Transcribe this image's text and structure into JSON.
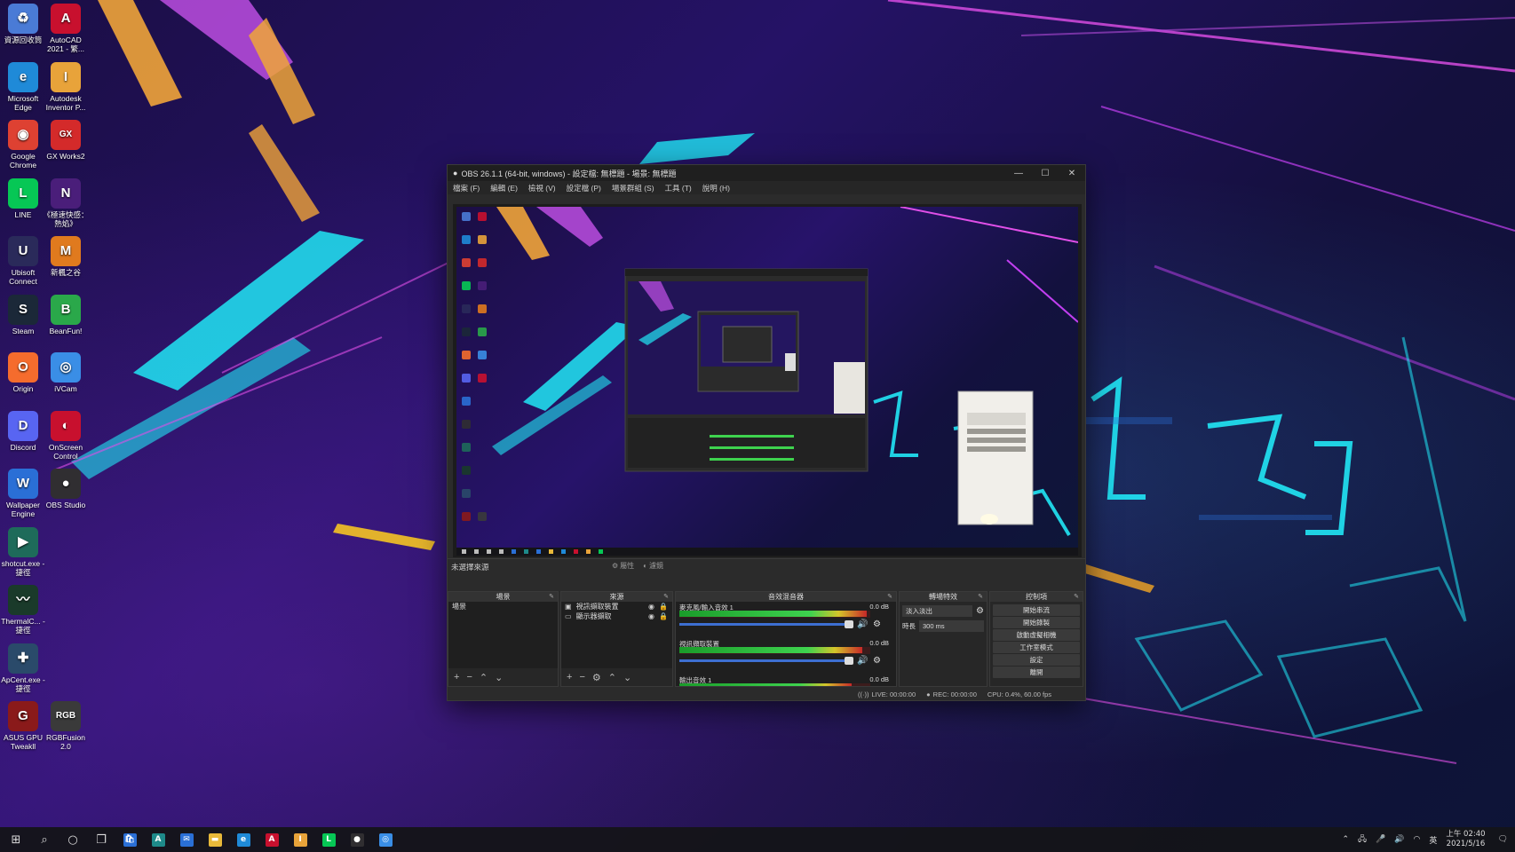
{
  "desktop": {
    "icons": [
      {
        "label": "資源回收筒",
        "icon": "recycle-bin-icon",
        "color": "#4a7bd6",
        "glyph": "♻"
      },
      {
        "label": "AutoCAD 2021 - 繁...",
        "icon": "autocad-icon",
        "color": "#c8102e",
        "glyph": "A"
      },
      {
        "label": "Microsoft Edge",
        "icon": "edge-icon",
        "color": "#1f8ad8",
        "glyph": "e"
      },
      {
        "label": "Autodesk Inventor P...",
        "icon": "inventor-icon",
        "color": "#e8a33a",
        "glyph": "I"
      },
      {
        "label": "Google Chrome",
        "icon": "chrome-icon",
        "color": "#de4132",
        "glyph": "◉"
      },
      {
        "label": "GX Works2",
        "icon": "gxworks-icon",
        "color": "#d42a2a",
        "glyph": "GX"
      },
      {
        "label": "LINE",
        "icon": "line-icon",
        "color": "#06c755",
        "glyph": "L"
      },
      {
        "label": "《極速快感：熱焰》",
        "icon": "nfs-icon",
        "color": "#4a1e7a",
        "glyph": "N"
      },
      {
        "label": "Ubisoft Connect",
        "icon": "ubisoft-icon",
        "color": "#2a2a5a",
        "glyph": "U"
      },
      {
        "label": "新楓之谷",
        "icon": "maplestory-icon",
        "color": "#e07a1e",
        "glyph": "M"
      },
      {
        "label": "Steam",
        "icon": "steam-icon",
        "color": "#1b2838",
        "glyph": "S"
      },
      {
        "label": "BeanFun!",
        "icon": "beanfun-icon",
        "color": "#2aa84a",
        "glyph": "B"
      },
      {
        "label": "Origin",
        "icon": "origin-icon",
        "color": "#f56c2d",
        "glyph": "O"
      },
      {
        "label": "iVCam",
        "icon": "ivcam-icon",
        "color": "#3a8ee6",
        "glyph": "◎"
      },
      {
        "label": "Discord",
        "icon": "discord-icon",
        "color": "#5865f2",
        "glyph": "D"
      },
      {
        "label": "OnScreen Control",
        "icon": "onscreen-control-icon",
        "color": "#c8102e",
        "glyph": "◐"
      },
      {
        "label": "Wallpaper Engine",
        "icon": "wallpaper-engine-icon",
        "color": "#2a6fd6",
        "glyph": "W"
      },
      {
        "label": "OBS Studio",
        "icon": "obs-icon",
        "color": "#302e31",
        "glyph": "●"
      },
      {
        "label": "shotcut.exe - 捷徑",
        "icon": "shotcut-icon",
        "color": "#1e6b5a",
        "glyph": "▶"
      },
      {
        "label": "ThermalC... - 捷徑",
        "icon": "thermal-icon",
        "color": "#1a3a2a",
        "glyph": "〰"
      },
      {
        "label": "ApCent.exe - 捷徑",
        "icon": "apcent-icon",
        "color": "#2a4a6a",
        "glyph": "✚"
      },
      {
        "label": "ASUS GPU Tweakll",
        "icon": "gpu-tweak-icon",
        "color": "#8a1a1a",
        "glyph": "G"
      },
      {
        "label": "RGBFusion 2.0",
        "icon": "rgbfusion-icon",
        "color": "#3a3a3a",
        "glyph": "RGB"
      }
    ]
  },
  "obs": {
    "title": "OBS 26.1.1 (64-bit, windows) - 設定檔: 無標題 - 場景: 無標題",
    "window_controls": {
      "minimize": "—",
      "maximize": "☐",
      "close": "✕"
    },
    "menu": [
      "檔案 (F)",
      "編輯 (E)",
      "檢視 (V)",
      "設定檔 (P)",
      "場景群組 (S)",
      "工具 (T)",
      "說明 (H)"
    ],
    "source_bar": {
      "no_source": "未選擇來源",
      "properties": "屬性",
      "filters": "濾鏡"
    },
    "scenes": {
      "header": "場景",
      "items": [
        "場景"
      ]
    },
    "sources": {
      "header": "來源",
      "items": [
        "視訊擷取裝置",
        "顯示器擷取"
      ]
    },
    "mixer": {
      "header": "音效混音器",
      "channels": [
        {
          "name": "麥克風/輸入音效 1",
          "db": "0.0 dB",
          "level": 0.98
        },
        {
          "name": "視訊擷取裝置",
          "db": "0.0 dB",
          "level": 0.96
        },
        {
          "name": "輸出音效 1",
          "db": "0.0 dB",
          "level": 0.9
        }
      ]
    },
    "transitions": {
      "header": "轉場特效",
      "type": "淡入淡出",
      "duration_label": "時長",
      "duration": "300 ms"
    },
    "controls": {
      "header": "控制項",
      "buttons": [
        "開始串流",
        "開始錄製",
        "啟動虛擬相機",
        "工作室模式",
        "設定",
        "離開"
      ]
    },
    "status": {
      "live": "LIVE: 00:00:00",
      "rec": "REC: 00:00:00",
      "cpu": "CPU: 0.4%, 60.00 fps"
    }
  },
  "taskbar": {
    "apps": [
      {
        "icon": "start-icon",
        "glyph": "⊞",
        "color": ""
      },
      {
        "icon": "search-icon",
        "glyph": "⌕",
        "color": ""
      },
      {
        "icon": "cortana-icon",
        "glyph": "○",
        "color": ""
      },
      {
        "icon": "task-view-icon",
        "glyph": "❐",
        "color": ""
      },
      {
        "icon": "store-icon",
        "glyph": "🛍",
        "color": "#2a6fd6"
      },
      {
        "icon": "autodesk-icon",
        "glyph": "A",
        "color": "#1e8a8a"
      },
      {
        "icon": "mail-icon",
        "glyph": "✉",
        "color": "#2a6fd6"
      },
      {
        "icon": "file-explorer-icon",
        "glyph": "▬",
        "color": "#e8b93a"
      },
      {
        "icon": "edge-icon",
        "glyph": "e",
        "color": "#1f8ad8"
      },
      {
        "icon": "autocad-icon",
        "glyph": "A",
        "color": "#c8102e"
      },
      {
        "icon": "inventor-icon",
        "glyph": "I",
        "color": "#e8a33a"
      },
      {
        "icon": "line-icon",
        "glyph": "L",
        "color": "#06c755"
      },
      {
        "icon": "obs-icon",
        "glyph": "●",
        "color": "#302e31"
      },
      {
        "icon": "ivcam-icon",
        "glyph": "◎",
        "color": "#3a8ee6"
      }
    ],
    "tray": {
      "time": "上午 02:40",
      "date": "2021/5/16"
    }
  },
  "colors": {
    "accent": "#3d6fd1",
    "neon_cyan": "#21e6f5",
    "neon_purple": "#c13ff0",
    "neon_orange": "#f5a623"
  }
}
